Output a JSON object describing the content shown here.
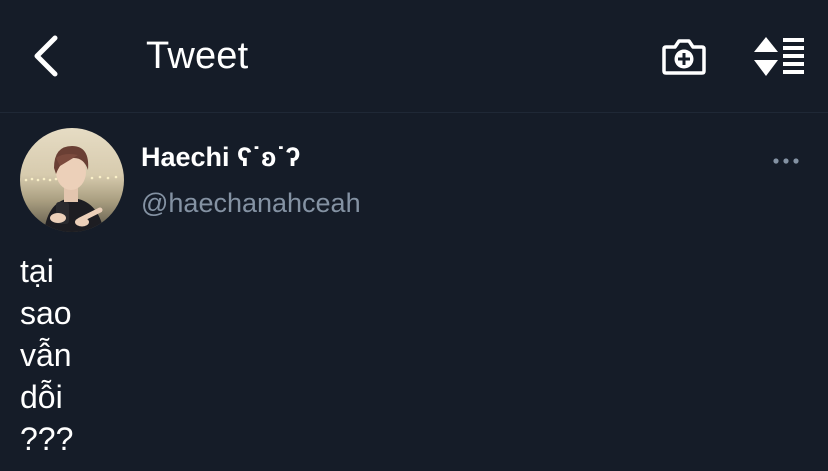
{
  "header": {
    "title": "Tweet",
    "back_icon": "chevron-left-icon",
    "camera_icon": "camera-plus-icon",
    "sort_icon": "sort-list-icon"
  },
  "tweet": {
    "display_name": "Haechi ʕ˙ʚ˙ʔ",
    "handle": "@haechanahceah",
    "more_icon": "more-horizontal-icon",
    "text_lines": [
      "tại",
      "sao",
      "vẫn",
      "dỗi",
      "???"
    ]
  },
  "colors": {
    "background": "#151c28",
    "text": "#ffffff",
    "secondary_text": "#8492a3",
    "divider": "#1f2836"
  }
}
